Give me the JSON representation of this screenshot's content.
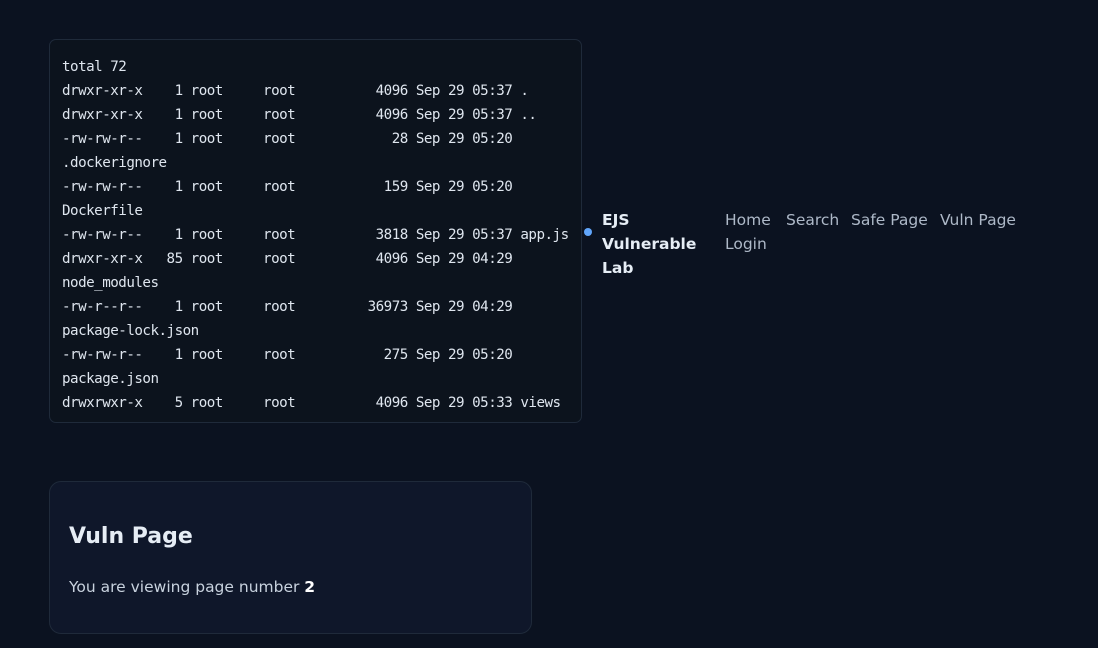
{
  "terminal": {
    "lines": [
      "total 72",
      "drwxr-xr-x    1 root     root          4096 Sep 29 05:37 .",
      "drwxr-xr-x    1 root     root          4096 Sep 29 05:37 ..",
      "-rw-rw-r--    1 root     root            28 Sep 29 05:20",
      ".dockerignore",
      "-rw-rw-r--    1 root     root           159 Sep 29 05:20",
      "Dockerfile",
      "-rw-rw-r--    1 root     root          3818 Sep 29 05:37 app.js",
      "drwxr-xr-x   85 root     root          4096 Sep 29 04:29",
      "node_modules",
      "-rw-r--r--    1 root     root         36973 Sep 29 04:29",
      "package-lock.json",
      "-rw-rw-r--    1 root     root           275 Sep 29 05:20",
      "package.json",
      "drwxrwxr-x    5 root     root          4096 Sep 29 05:33 views"
    ]
  },
  "nav": {
    "brand": "EJS Vulnerable Lab",
    "links": [
      "Home",
      "Search",
      "Safe Page",
      "Vuln Page",
      "Login"
    ],
    "accent_color": "#60a5fa"
  },
  "card": {
    "title": "Vuln Page",
    "text_prefix": "You are viewing page number ",
    "page_number": "2"
  }
}
